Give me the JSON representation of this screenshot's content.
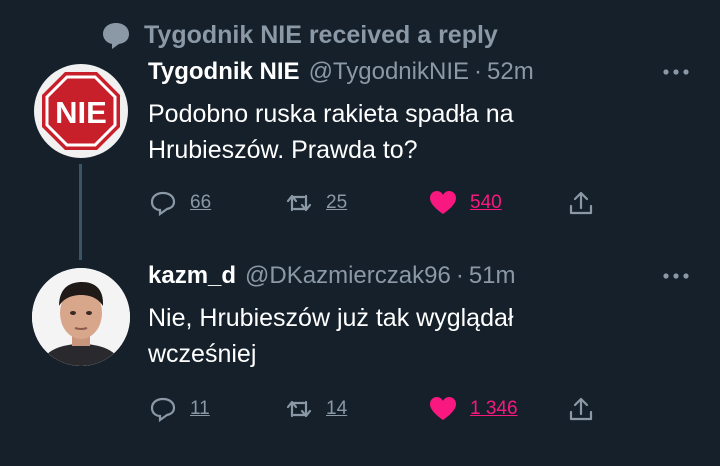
{
  "notification": {
    "text": "Tygodnik NIE received a reply"
  },
  "tweets": [
    {
      "name": "Tygodnik NIE",
      "handle": "@TygodnikNIE",
      "separator": "·",
      "time": "52m",
      "avatar_text": "NIE",
      "text": "Podobno ruska rakieta spadła na Hrubieszów. Prawda to?",
      "replies": "66",
      "retweets": "25",
      "likes": "540"
    },
    {
      "name": "kazm_d",
      "handle": "@DKazmierczak96",
      "separator": "·",
      "time": "51m",
      "text": "Nie, Hrubieszów już tak wyglądał wcześniej",
      "replies": "11",
      "retweets": "14",
      "likes": "1 346"
    }
  ],
  "colors": {
    "background": "#15202b",
    "secondary_text": "#8b98a5",
    "like_pink": "#f91880",
    "stop_red": "#c8202a"
  }
}
